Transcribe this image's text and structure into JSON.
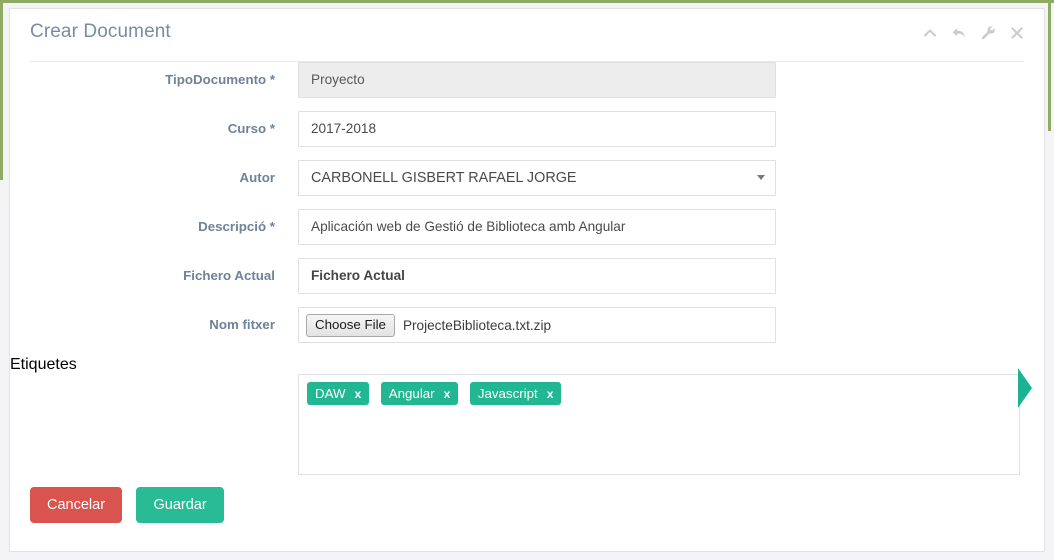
{
  "window": {
    "title": "Crear Document",
    "icons": [
      {
        "name": "chevron-up-icon",
        "label": "collapse"
      },
      {
        "name": "undo-arrow-icon",
        "label": "reload"
      },
      {
        "name": "wrench-icon",
        "label": "settings"
      },
      {
        "name": "close-icon",
        "label": "close"
      }
    ]
  },
  "colors": {
    "title": "#7b8ba5",
    "label": "#6f8299",
    "tag": "#21b793",
    "save": "#28bb96",
    "cancel": "#d9534f",
    "frame_green": "#8faa63",
    "edge_arrow": "#1bb394"
  },
  "form": {
    "fields": [
      {
        "key": "tipodocumento",
        "label": "TipoDocumento *",
        "type": "text",
        "value": "Proyecto",
        "disabled": true
      },
      {
        "key": "curso",
        "label": "Curso *",
        "type": "text",
        "value": "2017-2018",
        "disabled": false
      },
      {
        "key": "autor",
        "label": "Autor",
        "type": "select",
        "value": "CARBONELL GISBERT RAFAEL JORGE",
        "disabled": false
      },
      {
        "key": "descripcio",
        "label": "Descripció *",
        "type": "text",
        "value": "Aplicación web de Gestió de Biblioteca amb Angular",
        "disabled": false
      },
      {
        "key": "fichero-actual",
        "label": "Fichero Actual",
        "type": "text",
        "value": "Fichero Actual",
        "disabled": false
      },
      {
        "key": "nom-fitxer",
        "label": "Nom fitxer",
        "type": "file",
        "button_label": "Choose File",
        "value": "ProjecteBiblioteca.txt.zip",
        "disabled": false
      }
    ],
    "tags_label": "Etiquetes",
    "tags": [
      {
        "label": "DAW",
        "remove": "x"
      },
      {
        "label": "Angular",
        "remove": "x"
      },
      {
        "label": "Javascript",
        "remove": "x"
      }
    ]
  },
  "footer": {
    "cancel_label": "Cancelar",
    "save_label": "Guardar"
  }
}
